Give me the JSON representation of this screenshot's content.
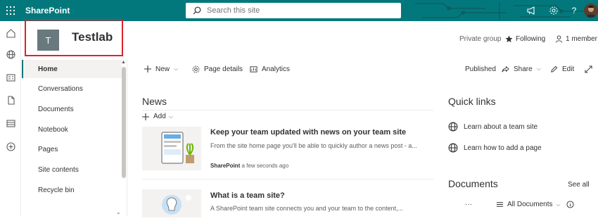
{
  "suitebar": {
    "app_name": "SharePoint",
    "search_placeholder": "Search this site",
    "accent": "#03787c",
    "icons": [
      "waffle-icon",
      "megaphone-icon",
      "settings-icon",
      "help-icon"
    ]
  },
  "site": {
    "logo_letter": "T",
    "title": "Testlab",
    "privacy": "Private group",
    "following": "Following",
    "members": "1 member"
  },
  "nav": {
    "items": [
      {
        "label": "Home",
        "active": true
      },
      {
        "label": "Conversations"
      },
      {
        "label": "Documents"
      },
      {
        "label": "Notebook"
      },
      {
        "label": "Pages"
      },
      {
        "label": "Site contents"
      },
      {
        "label": "Recycle bin"
      }
    ]
  },
  "commandbar": {
    "new": "New",
    "page_details": "Page details",
    "analytics": "Analytics",
    "published": "Published",
    "share": "Share",
    "edit": "Edit"
  },
  "news": {
    "title": "News",
    "add": "Add",
    "cards": [
      {
        "title": "Keep your team updated with news on your team site",
        "desc": "From the site home page you'll be able to quickly author a news post - a...",
        "author": "SharePoint",
        "time": "a few seconds ago"
      },
      {
        "title": "What is a team site?",
        "desc": "A SharePoint team site connects you and your team to the content,..."
      }
    ]
  },
  "quick_links": {
    "title": "Quick links",
    "items": [
      "Learn about a team site",
      "Learn how to add a page"
    ]
  },
  "documents": {
    "title": "Documents",
    "see_all": "See all",
    "more": "···",
    "view": "All Documents"
  }
}
